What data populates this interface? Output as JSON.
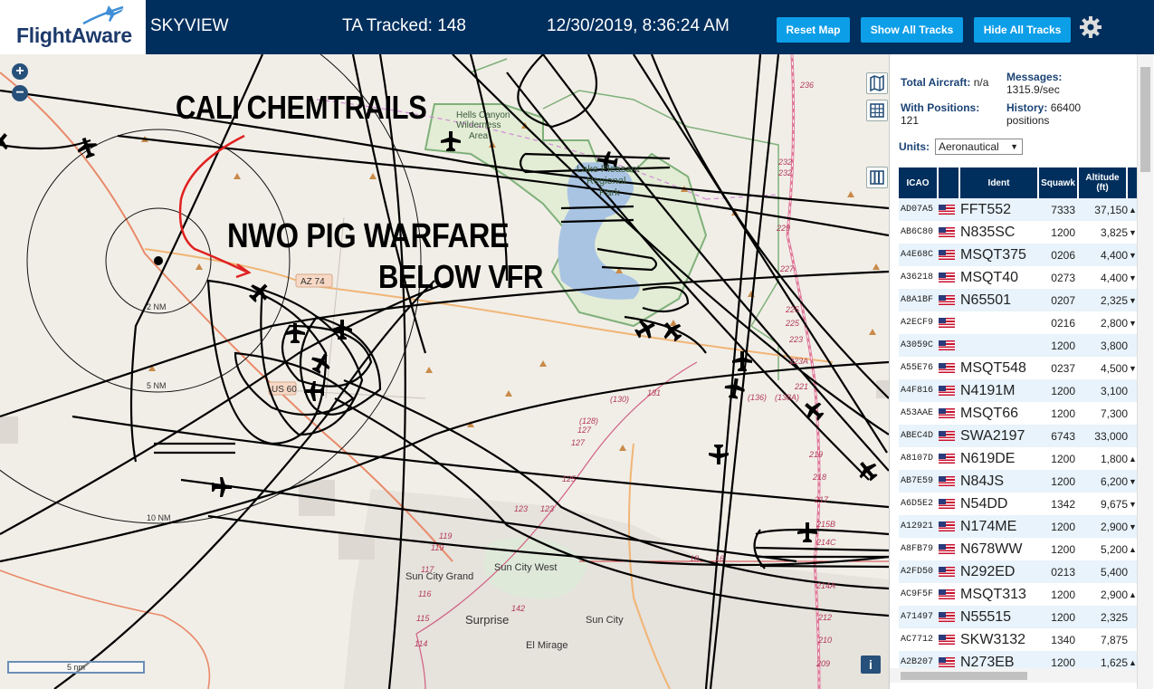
{
  "header": {
    "brand": "FlightAware",
    "app_name": "SKYVIEW",
    "tracked_label": "TA Tracked: 148",
    "datetime": "12/30/2019, 8:36:24 AM",
    "buttons": {
      "reset": "Reset Map",
      "show": "Show All Tracks",
      "hide": "Hide All Tracks"
    },
    "colors": {
      "bar": "#002f5d",
      "button": "#0d9ee8"
    }
  },
  "map": {
    "zoom_in": "+",
    "zoom_out": "−",
    "scale_label": "5 nm",
    "info": "i",
    "annotations": {
      "chemtrails": "CALI CHEMTRAILS",
      "warfare": "NWO PIG WARFARE",
      "vfr": "BELOW VFR"
    },
    "labels": {
      "wilderness1": "Hells Canyon",
      "wilderness2": "Wilderness",
      "wilderness3": "Area",
      "lake1": "Lake Pleasant",
      "lake2": "Regional",
      "lake3": "Park",
      "az74": "AZ 74",
      "us60": "US 60",
      "ring2": "2 NM",
      "ring5": "5 NM",
      "ring10": "10 NM",
      "suncitygrand": "Sun City Grand",
      "suncitywest": "Sun City West",
      "suncity": "Sun City",
      "surprise": "Surprise",
      "elmirage": "El Mirage"
    },
    "route_numbers": [
      "236",
      "232",
      "232",
      "229",
      "227",
      "225",
      "225",
      "223",
      "223A",
      "221",
      "219",
      "218",
      "217",
      "215B",
      "214C",
      "214A",
      "212",
      "210",
      "209",
      "131",
      "(130)",
      "(128)",
      "127",
      "127",
      "125",
      "123",
      "123",
      "119",
      "119",
      "117",
      "116",
      "115",
      "114",
      "142",
      "18",
      "16",
      "(138A)",
      "(136)"
    ]
  },
  "panel": {
    "total_label": "Total Aircraft:",
    "total_value": "n/a",
    "positions_label": "With Positions:",
    "positions_value": "121",
    "messages_label": "Messages:",
    "messages_value": "1315.9/sec",
    "history_label": "History:",
    "history_value": "66400",
    "history_unit": "positions",
    "units_label": "Units:",
    "units_value": "Aeronautical",
    "columns": {
      "icao": "ICAO",
      "ident": "Ident",
      "squawk": "Squawk",
      "altitude": "Altitude (ft)"
    },
    "rows": [
      {
        "icao": "AD07A5",
        "ident": "FFT552",
        "squawk": "7333",
        "alt": "37,150",
        "dir": "▲"
      },
      {
        "icao": "AB6C80",
        "ident": "N835SC",
        "squawk": "1200",
        "alt": "3,825",
        "dir": "▼"
      },
      {
        "icao": "A4E68C",
        "ident": "MSQT375",
        "squawk": "0206",
        "alt": "4,400",
        "dir": "▼"
      },
      {
        "icao": "A36218",
        "ident": "MSQT40",
        "squawk": "0273",
        "alt": "4,400",
        "dir": "▼"
      },
      {
        "icao": "A8A1BF",
        "ident": "N65501",
        "squawk": "0207",
        "alt": "2,325",
        "dir": "▼"
      },
      {
        "icao": "A2ECF9",
        "ident": "",
        "squawk": "0216",
        "alt": "2,800",
        "dir": "▼"
      },
      {
        "icao": "A3059C",
        "ident": "",
        "squawk": "1200",
        "alt": "3,800",
        "dir": ""
      },
      {
        "icao": "A55E76",
        "ident": "MSQT548",
        "squawk": "0237",
        "alt": "4,500",
        "dir": "▼"
      },
      {
        "icao": "A4F816",
        "ident": "N4191M",
        "squawk": "1200",
        "alt": "3,100",
        "dir": ""
      },
      {
        "icao": "A53AAE",
        "ident": "MSQT66",
        "squawk": "1200",
        "alt": "7,300",
        "dir": ""
      },
      {
        "icao": "ABEC4D",
        "ident": "SWA2197",
        "squawk": "6743",
        "alt": "33,000",
        "dir": ""
      },
      {
        "icao": "A8107D",
        "ident": "N619DE",
        "squawk": "1200",
        "alt": "1,800",
        "dir": "▲"
      },
      {
        "icao": "AB7E59",
        "ident": "N84JS",
        "squawk": "1200",
        "alt": "6,200",
        "dir": "▼"
      },
      {
        "icao": "A6D5E2",
        "ident": "N54DD",
        "squawk": "1342",
        "alt": "9,675",
        "dir": "▼"
      },
      {
        "icao": "A12921",
        "ident": "N174ME",
        "squawk": "1200",
        "alt": "2,900",
        "dir": "▼"
      },
      {
        "icao": "A8FB79",
        "ident": "N678WW",
        "squawk": "1200",
        "alt": "5,200",
        "dir": "▲"
      },
      {
        "icao": "A2FD50",
        "ident": "N292ED",
        "squawk": "0213",
        "alt": "5,400",
        "dir": ""
      },
      {
        "icao": "AC9F5F",
        "ident": "MSQT313",
        "squawk": "1200",
        "alt": "2,900",
        "dir": "▲"
      },
      {
        "icao": "A71497",
        "ident": "N55515",
        "squawk": "1200",
        "alt": "2,325",
        "dir": ""
      },
      {
        "icao": "AC7712",
        "ident": "SKW3132",
        "squawk": "1340",
        "alt": "7,875",
        "dir": ""
      },
      {
        "icao": "A2B207",
        "ident": "N273EB",
        "squawk": "1200",
        "alt": "1,625",
        "dir": "▲"
      }
    ]
  }
}
